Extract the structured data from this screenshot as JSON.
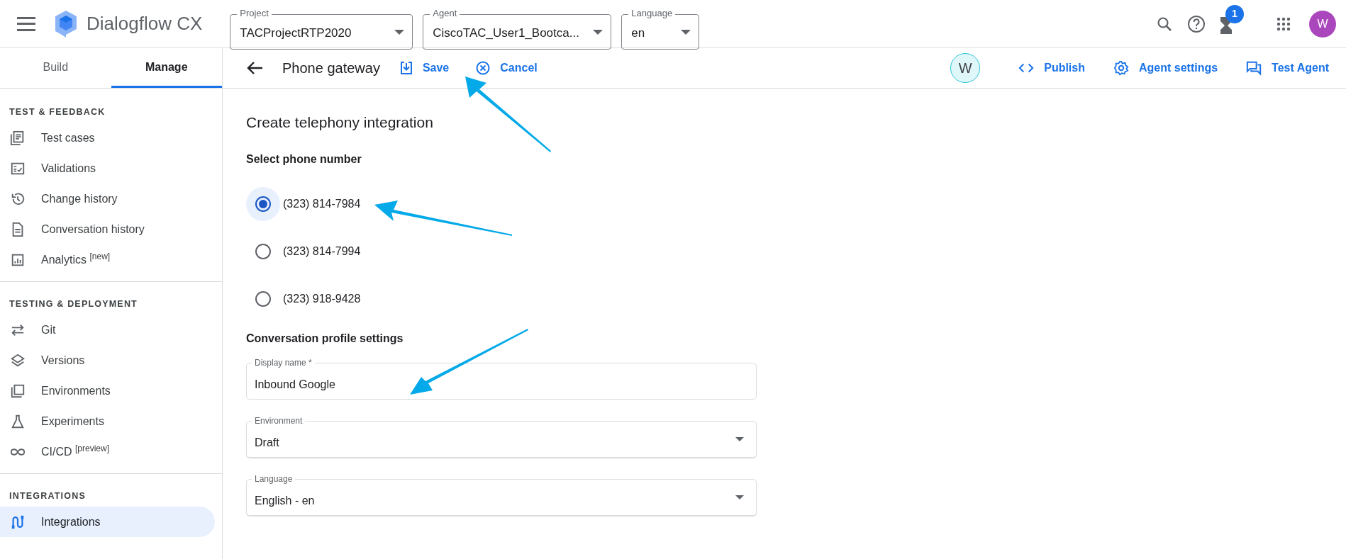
{
  "app": {
    "title": "Dialogflow CX"
  },
  "top_selectors": [
    {
      "label": "Project",
      "value": "TACProjectRTP2020"
    },
    {
      "label": "Agent",
      "value": "CiscoTAC_User1_Bootca..."
    },
    {
      "label": "Language",
      "value": "en"
    }
  ],
  "notification_badge": "1",
  "account_avatar": "W",
  "tabs": [
    {
      "label": "Build",
      "selected": false
    },
    {
      "label": "Manage",
      "selected": true
    }
  ],
  "sidebar": {
    "sections": [
      {
        "title": "TEST & FEEDBACK",
        "items": [
          {
            "label": "Test cases",
            "selected": false
          },
          {
            "label": "Validations",
            "selected": false
          },
          {
            "label": "Change history",
            "selected": false
          },
          {
            "label": "Conversation history",
            "selected": false
          },
          {
            "label": "Analytics $^{[new]}$",
            "selected": false
          }
        ]
      },
      {
        "title": "TESTING & DEPLOYMENT",
        "items": [
          {
            "label": "Git",
            "selected": false
          },
          {
            "label": "Versions",
            "selected": false
          },
          {
            "label": "Environments",
            "selected": false
          },
          {
            "label": "Experiments",
            "selected": false
          },
          {
            "label": "CI/CD $^{[preview]}$",
            "selected": false
          }
        ]
      },
      {
        "title": "INTEGRATIONS",
        "items": [
          {
            "label": "Integrations",
            "selected": true
          }
        ]
      }
    ]
  },
  "page_header": {
    "title": "Phone gateway",
    "save": "Save",
    "cancel": "Cancel",
    "user_avatar": "W",
    "actions": [
      "Publish",
      "Agent settings",
      "Test Agent"
    ]
  },
  "form": {
    "title": "Create telephony integration",
    "phone_section": "Select phone number",
    "phone_numbers": [
      {
        "label": "(323) 814-7984",
        "selected": true
      },
      {
        "label": "(323) 814-7994",
        "selected": false
      },
      {
        "label": "(323) 918-9428",
        "selected": false
      }
    ],
    "profile_section": "Conversation profile settings",
    "fields": [
      {
        "kind": "text",
        "label": "Display name *",
        "value": "Inbound Google"
      },
      {
        "kind": "select",
        "label": "Environment",
        "value": "Draft"
      },
      {
        "kind": "select",
        "label": "Language",
        "value": "English - en"
      }
    ]
  }
}
